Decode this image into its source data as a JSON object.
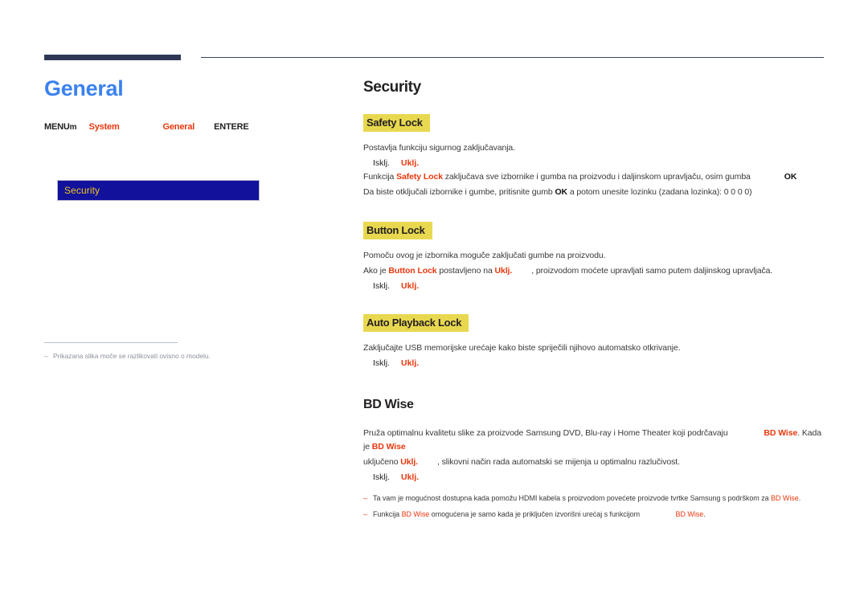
{
  "page": {
    "title": "General",
    "menu_path": {
      "menu_key": "MENU",
      "arrow1": "m",
      "step1": "System",
      "arrow2": "",
      "step2": "General",
      "arrow3": "",
      "enter_key": "ENTER",
      "enter_sym": "E"
    },
    "osd": {
      "selected_item": "Security"
    },
    "left_note": {
      "bullet": "–",
      "text": "Prikazana slika moče se razlikovati ovisno o modelu."
    }
  },
  "security": {
    "heading": "Security",
    "safety_lock": {
      "sub_head": "Safety Lock",
      "desc": "Postavlja funkciju sigurnog zaključavanja.",
      "option_label": "Isklj.",
      "option_value": "Uklj.",
      "line1_pre": "Funkcija ",
      "line1_term": "Safety Lock",
      "line1_post": " zaključava sve izbornike i gumba na proizvodu i daljinskom upravljaču, osim gumba",
      "line1_key": "OK",
      "line2_pre": "Da biste otključali izbornike i gumbe, pritisnite gumb ",
      "line2_key": "OK",
      "line2_post": " a potom unesite lozinku (zadana lozinka): 0 0 0 0)"
    },
    "button_lock": {
      "sub_head": "Button Lock",
      "desc": "Pomoču ovog je izbornika moguče zaključati gumbe na proizvodu.",
      "line1_pre": "Ako je ",
      "line1_term": "Button Lock",
      "line1_mid": " postavljeno na ",
      "line1_val": "Uklj.",
      "line1_post": ", proizvodom moćete upravljati samo putem daljinskog upravljača.",
      "option_label": "Isklj.",
      "option_value": "Uklj."
    },
    "auto_playback_lock": {
      "sub_head": "Auto Playback Lock",
      "desc_pre": "Zaključajte ",
      "desc_term": "USB",
      "desc_post": " memorijske urećaje kako biste spriječili njihovo automatsko otkrivanje.",
      "option_label": "Isklj.",
      "option_value": "Uklj."
    }
  },
  "bd_wise": {
    "heading": "BD Wise",
    "line1_pre": "Pruža optimalnu kvalitetu slike za proizvode Samsung DVD, Blu-ray i Home Theater koji podrčavaju ",
    "line1_term": "BD Wise",
    "line1_mid": ". Kada je ",
    "line1_term2": "BD Wise",
    "line2_pre": "uključeno ",
    "line2_val": "Uklj.",
    "line2_post": ", slikovni način rada automatski se mijenja u optimalnu razlučivost.",
    "option_label": "Isklj.",
    "option_value": "Uklj.",
    "footnotes": [
      {
        "bullet": "–",
        "pre": "Ta vam je mogućnost dostupna kada pomožu HDMI kabela s proizvodom povećete proizvode tvrtke Samsung s podrškom za ",
        "term": "BD Wise",
        "post": "."
      },
      {
        "bullet": "–",
        "pre": "Funkcija ",
        "term": "BD Wise",
        "mid": " omogućena je samo kada je priključen izvorišni urećaj s funkcijom ",
        "term2": "BD Wise",
        "post": "."
      }
    ]
  },
  "colors": {
    "accent_blue": "#3b82f0",
    "rule_navy": "#2e3756",
    "highlight_yellow": "#e8d84f",
    "term_red": "#e8380d",
    "osd_blue": "#11119c",
    "osd_text_gold": "#f0c419"
  }
}
